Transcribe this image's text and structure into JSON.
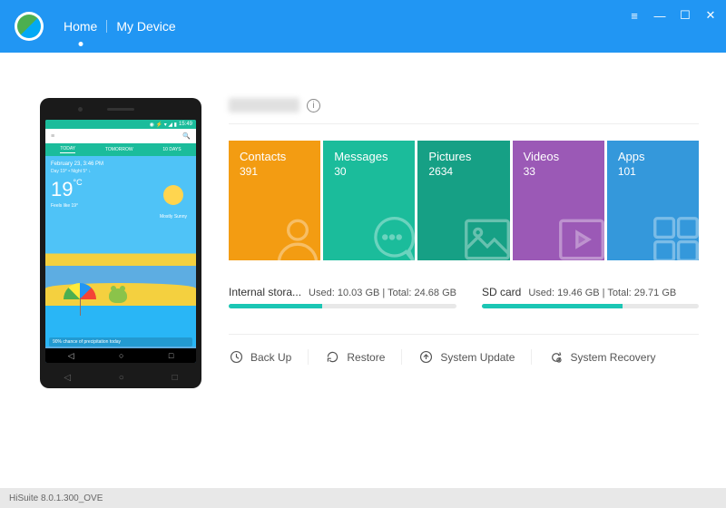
{
  "nav": {
    "home": "Home",
    "my_device": "My Device"
  },
  "window": {
    "menu": "≡",
    "min": "—",
    "max": "☐",
    "close": "✕"
  },
  "phone": {
    "status_time": "15:49",
    "tabs": [
      "TODAY",
      "TOMORROW",
      "10 DAYS"
    ],
    "date": "February 23, 3:46 PM",
    "sub": "Day 19° • Night 5° ↓",
    "temp": "19",
    "unit": "°C",
    "feels": "Feels like 19°",
    "cond": "Mostly Sunny",
    "precip": "90% chance of precipitation today",
    "nav": [
      "◁",
      "○",
      "□"
    ]
  },
  "tiles": [
    {
      "label": "Contacts",
      "count": "391",
      "color": "#f39c12"
    },
    {
      "label": "Messages",
      "count": "30",
      "color": "#1bbc9b"
    },
    {
      "label": "Pictures",
      "count": "2634",
      "color": "#16a085"
    },
    {
      "label": "Videos",
      "count": "33",
      "color": "#9b59b6"
    },
    {
      "label": "Apps",
      "count": "101",
      "color": "#3498db"
    }
  ],
  "storage": {
    "internal": {
      "label": "Internal stora...",
      "used": "10.03 GB",
      "total": "24.68 GB",
      "pct": 41
    },
    "sd": {
      "label": "SD card",
      "used": "19.46 GB",
      "total": "29.71 GB",
      "pct": 65
    }
  },
  "storage_text": {
    "used": "Used:",
    "total": "Total:",
    "sep": " | "
  },
  "actions": {
    "backup": "Back Up",
    "restore": "Restore",
    "update": "System Update",
    "recovery": "System Recovery"
  },
  "footer": "HiSuite 8.0.1.300_OVE"
}
